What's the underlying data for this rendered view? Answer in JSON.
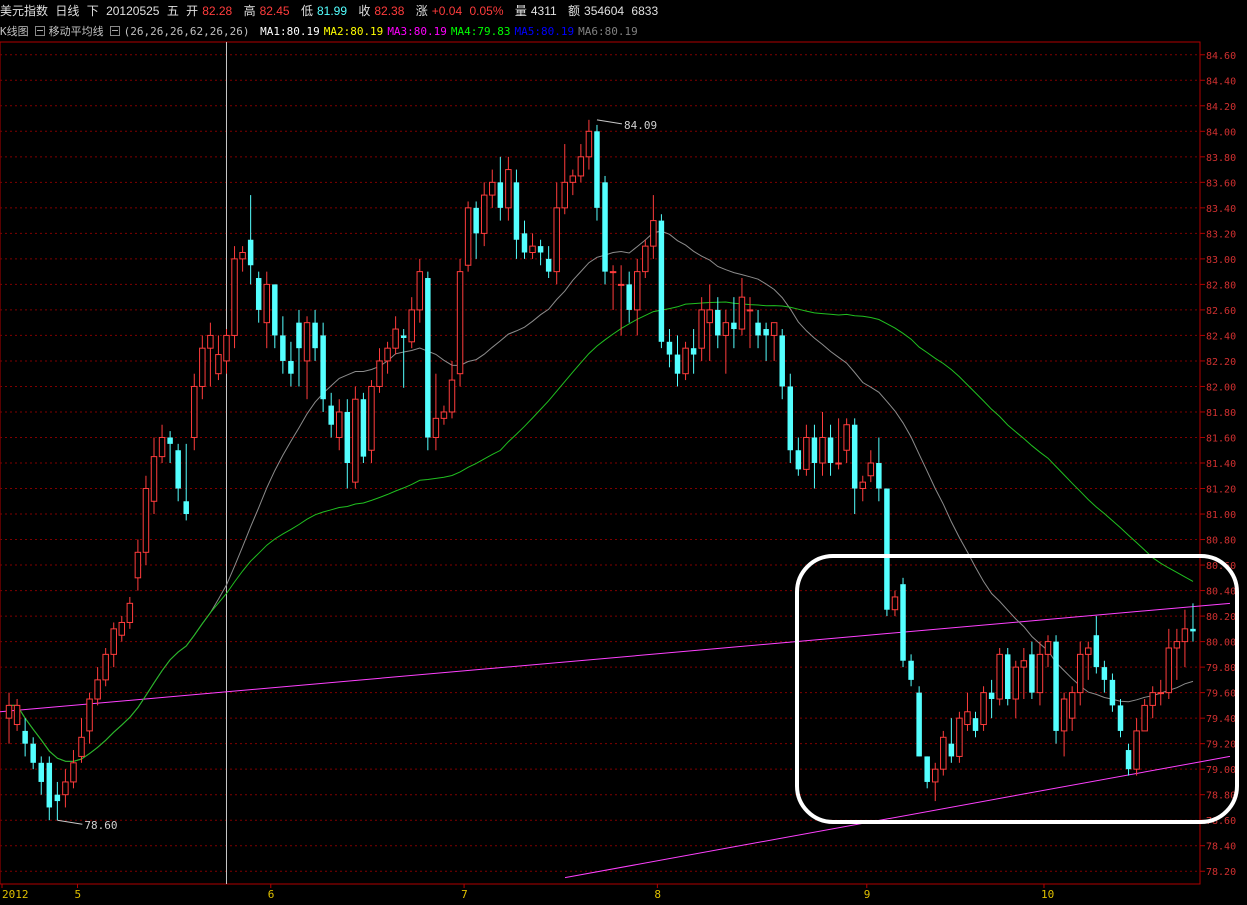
{
  "header": {
    "name": "美元指数",
    "period": "日线",
    "nav": "下",
    "date": "20120525",
    "weekday": "五",
    "open_label": "开",
    "open": "82.28",
    "high_label": "高",
    "high": "82.45",
    "low_label": "低",
    "low": "81.99",
    "close_label": "收",
    "close": "82.38",
    "change_label": "涨",
    "change": "+0.04",
    "change_pct": "0.05%",
    "volume_label": "量",
    "volume": "4311",
    "amount_label": "额",
    "amount": "354604",
    "extra": "6833"
  },
  "indicator_bar": {
    "kline_label": "K线图",
    "ma_label": "移动平均线",
    "ma_params": "(26,26,26,62,26,26)",
    "ma": [
      {
        "label": "MA1:80.19",
        "color": "#ffffff"
      },
      {
        "label": "MA2:80.19",
        "color": "#ffff00"
      },
      {
        "label": "MA3:80.19",
        "color": "#ff00ff"
      },
      {
        "label": "MA4:79.83",
        "color": "#00ff00"
      },
      {
        "label": "MA5:80.19",
        "color": "#0000ff"
      },
      {
        "label": "MA6:80.19",
        "color": "#808080"
      }
    ]
  },
  "colors": {
    "up": "#ff3c3c",
    "down": "#54ffff",
    "grid": "#800000",
    "axis": "#b00000",
    "ma_gray": "#8c8c8c",
    "ma_green": "#20c020",
    "trend": "#ff40ff",
    "highlight": "#ffffff"
  },
  "chart_data": {
    "type": "candlestick",
    "ylim": [
      78.1,
      84.7
    ],
    "y_ticks": [
      "84.60",
      "84.40",
      "84.20",
      "84.00",
      "83.80",
      "83.60",
      "83.40",
      "83.20",
      "83.00",
      "82.80",
      "82.60",
      "82.40",
      "82.20",
      "82.00",
      "81.80",
      "81.60",
      "81.40",
      "81.20",
      "81.00",
      "80.80",
      "80.60",
      "80.40",
      "80.20",
      "80.00",
      "79.80",
      "79.60",
      "79.40",
      "79.20",
      "79.00",
      "78.80",
      "78.60",
      "78.40",
      "78.20"
    ],
    "x_labels": [
      {
        "label": "2012",
        "index": 0
      },
      {
        "label": "5",
        "index": 9
      },
      {
        "label": "6",
        "index": 33
      },
      {
        "label": "7",
        "index": 57
      },
      {
        "label": "8",
        "index": 81
      },
      {
        "label": "9",
        "index": 107
      },
      {
        "label": "10",
        "index": 129
      }
    ],
    "annotations": [
      {
        "text": "84.09",
        "index": 73,
        "value": 84.09
      },
      {
        "text": "78.60",
        "index": 6,
        "value": 78.6
      }
    ],
    "cursor_index": 27,
    "candles": [
      [
        79.4,
        79.5,
        79.2,
        79.6
      ],
      [
        79.35,
        79.5,
        79.3,
        79.55
      ],
      [
        79.3,
        79.2,
        79.1,
        79.4
      ],
      [
        79.2,
        79.05,
        79.0,
        79.25
      ],
      [
        79.05,
        78.9,
        78.8,
        79.1
      ],
      [
        79.05,
        78.7,
        78.6,
        79.1
      ],
      [
        78.8,
        78.75,
        78.6,
        78.9
      ],
      [
        78.8,
        78.9,
        78.7,
        79.0
      ],
      [
        78.9,
        79.05,
        78.85,
        79.15
      ],
      [
        79.1,
        79.25,
        79.05,
        79.4
      ],
      [
        79.3,
        79.55,
        79.2,
        79.6
      ],
      [
        79.55,
        79.7,
        79.5,
        79.8
      ],
      [
        79.7,
        79.9,
        79.65,
        79.95
      ],
      [
        79.9,
        80.1,
        79.8,
        80.15
      ],
      [
        80.05,
        80.15,
        80.0,
        80.2
      ],
      [
        80.15,
        80.3,
        80.1,
        80.35
      ],
      [
        80.5,
        80.7,
        80.4,
        80.8
      ],
      [
        80.7,
        81.2,
        80.6,
        81.3
      ],
      [
        81.1,
        81.45,
        81.0,
        81.6
      ],
      [
        81.45,
        81.6,
        81.4,
        81.7
      ],
      [
        81.6,
        81.55,
        81.4,
        81.65
      ],
      [
        81.5,
        81.2,
        81.1,
        81.55
      ],
      [
        81.1,
        81.0,
        80.95,
        81.55
      ],
      [
        81.6,
        82.0,
        81.5,
        82.1
      ],
      [
        82.0,
        82.3,
        81.9,
        82.4
      ],
      [
        82.3,
        82.4,
        82.0,
        82.5
      ],
      [
        82.1,
        82.25,
        82.05,
        82.4
      ],
      [
        82.2,
        82.4,
        82.1,
        82.45
      ],
      [
        82.4,
        83.0,
        82.3,
        83.1
      ],
      [
        83.0,
        83.05,
        82.9,
        83.1
      ],
      [
        83.15,
        82.95,
        82.8,
        83.5
      ],
      [
        82.85,
        82.6,
        82.5,
        82.9
      ],
      [
        82.5,
        82.8,
        82.3,
        82.9
      ],
      [
        82.8,
        82.4,
        82.3,
        82.8
      ],
      [
        82.4,
        82.2,
        82.1,
        82.55
      ],
      [
        82.2,
        82.1,
        82.0,
        82.35
      ],
      [
        82.5,
        82.3,
        82.0,
        82.6
      ],
      [
        82.2,
        82.5,
        81.9,
        82.55
      ],
      [
        82.5,
        82.3,
        82.2,
        82.6
      ],
      [
        82.4,
        81.9,
        81.8,
        82.5
      ],
      [
        81.85,
        81.7,
        81.6,
        81.95
      ],
      [
        81.6,
        81.8,
        81.5,
        81.9
      ],
      [
        81.8,
        81.4,
        81.2,
        81.9
      ],
      [
        81.25,
        81.9,
        81.2,
        82.0
      ],
      [
        81.9,
        81.45,
        81.4,
        81.95
      ],
      [
        81.5,
        82.0,
        81.4,
        82.05
      ],
      [
        82.0,
        82.2,
        81.95,
        82.3
      ],
      [
        82.2,
        82.3,
        82.1,
        82.35
      ],
      [
        82.3,
        82.45,
        82.25,
        82.55
      ],
      [
        82.4,
        82.38,
        81.99,
        82.45
      ],
      [
        82.35,
        82.6,
        82.3,
        82.7
      ],
      [
        82.6,
        82.9,
        82.5,
        83.0
      ],
      [
        82.85,
        81.6,
        81.5,
        82.9
      ],
      [
        81.6,
        81.75,
        81.5,
        82.1
      ],
      [
        81.75,
        81.8,
        81.7,
        81.85
      ],
      [
        81.8,
        82.05,
        81.75,
        82.2
      ],
      [
        82.1,
        82.9,
        82.0,
        83.0
      ],
      [
        82.95,
        83.4,
        82.9,
        83.45
      ],
      [
        83.4,
        83.2,
        83.0,
        83.45
      ],
      [
        83.2,
        83.5,
        83.1,
        83.6
      ],
      [
        83.5,
        83.6,
        83.4,
        83.7
      ],
      [
        83.6,
        83.4,
        83.3,
        83.8
      ],
      [
        83.4,
        83.7,
        83.3,
        83.8
      ],
      [
        83.6,
        83.15,
        83.0,
        83.7
      ],
      [
        83.2,
        83.05,
        83.0,
        83.3
      ],
      [
        83.05,
        83.1,
        83.0,
        83.2
      ],
      [
        83.1,
        83.05,
        82.95,
        83.15
      ],
      [
        83.0,
        82.9,
        82.85,
        83.1
      ],
      [
        82.9,
        83.4,
        82.8,
        83.6
      ],
      [
        83.4,
        83.6,
        83.35,
        83.9
      ],
      [
        83.6,
        83.65,
        83.5,
        83.7
      ],
      [
        83.65,
        83.8,
        83.6,
        83.9
      ],
      [
        83.8,
        84.0,
        83.7,
        84.09
      ],
      [
        84.0,
        83.4,
        83.3,
        84.05
      ],
      [
        83.6,
        82.9,
        82.8,
        83.65
      ],
      [
        82.9,
        82.9,
        82.6,
        82.95
      ],
      [
        82.8,
        82.8,
        82.4,
        82.95
      ],
      [
        82.8,
        82.6,
        82.5,
        82.9
      ],
      [
        82.6,
        82.9,
        82.4,
        83.0
      ],
      [
        82.9,
        83.1,
        82.85,
        83.15
      ],
      [
        83.1,
        83.3,
        83.0,
        83.5
      ],
      [
        83.3,
        82.35,
        82.3,
        83.35
      ],
      [
        82.35,
        82.25,
        82.15,
        82.45
      ],
      [
        82.25,
        82.1,
        82.0,
        82.4
      ],
      [
        82.1,
        82.3,
        82.05,
        82.35
      ],
      [
        82.3,
        82.25,
        82.1,
        82.45
      ],
      [
        82.3,
        82.6,
        82.2,
        82.7
      ],
      [
        82.5,
        82.6,
        82.2,
        82.8
      ],
      [
        82.6,
        82.4,
        82.3,
        82.7
      ],
      [
        82.4,
        82.5,
        82.1,
        82.6
      ],
      [
        82.5,
        82.45,
        82.3,
        82.7
      ],
      [
        82.45,
        82.7,
        82.4,
        82.85
      ],
      [
        82.6,
        82.6,
        82.3,
        82.7
      ],
      [
        82.5,
        82.4,
        82.3,
        82.6
      ],
      [
        82.45,
        82.4,
        82.2,
        82.5
      ],
      [
        82.4,
        82.5,
        82.2,
        82.5
      ],
      [
        82.4,
        82.0,
        81.9,
        82.45
      ],
      [
        82.0,
        81.5,
        81.4,
        82.1
      ],
      [
        81.5,
        81.35,
        81.3,
        81.6
      ],
      [
        81.35,
        81.6,
        81.3,
        81.7
      ],
      [
        81.6,
        81.4,
        81.2,
        81.7
      ],
      [
        81.4,
        81.6,
        81.3,
        81.8
      ],
      [
        81.6,
        81.4,
        81.3,
        81.7
      ],
      [
        81.4,
        81.4,
        81.35,
        81.75
      ],
      [
        81.5,
        81.7,
        81.4,
        81.75
      ],
      [
        81.7,
        81.2,
        81.0,
        81.75
      ],
      [
        81.2,
        81.25,
        81.1,
        81.3
      ],
      [
        81.3,
        81.4,
        81.25,
        81.5
      ],
      [
        81.4,
        81.2,
        81.1,
        81.6
      ],
      [
        81.2,
        80.25,
        80.2,
        81.2
      ],
      [
        80.25,
        80.35,
        80.2,
        80.4
      ],
      [
        80.45,
        79.85,
        79.8,
        80.5
      ],
      [
        79.85,
        79.7,
        79.65,
        79.9
      ],
      [
        79.6,
        79.1,
        79.1,
        79.65
      ],
      [
        79.1,
        78.9,
        78.85,
        79.1
      ],
      [
        78.9,
        79.0,
        78.75,
        79.05
      ],
      [
        79.0,
        79.25,
        78.95,
        79.3
      ],
      [
        79.2,
        79.1,
        79.05,
        79.4
      ],
      [
        79.1,
        79.4,
        79.05,
        79.45
      ],
      [
        79.35,
        79.45,
        79.3,
        79.6
      ],
      [
        79.4,
        79.3,
        79.25,
        79.45
      ],
      [
        79.35,
        79.6,
        79.3,
        79.65
      ],
      [
        79.6,
        79.55,
        79.4,
        79.7
      ],
      [
        79.55,
        79.9,
        79.5,
        79.95
      ],
      [
        79.9,
        79.55,
        79.5,
        79.95
      ],
      [
        79.55,
        79.8,
        79.4,
        79.85
      ],
      [
        79.8,
        79.85,
        79.55,
        79.95
      ],
      [
        79.9,
        79.6,
        79.55,
        80.0
      ],
      [
        79.6,
        79.9,
        79.5,
        80.0
      ],
      [
        79.9,
        80.0,
        79.8,
        80.05
      ],
      [
        80.0,
        79.3,
        79.2,
        80.05
      ],
      [
        79.3,
        79.55,
        79.1,
        79.6
      ],
      [
        79.4,
        79.6,
        79.3,
        79.65
      ],
      [
        79.6,
        79.9,
        79.5,
        80.0
      ],
      [
        79.9,
        79.95,
        79.7,
        80.0
      ],
      [
        80.05,
        79.8,
        79.75,
        80.2
      ],
      [
        79.8,
        79.7,
        79.6,
        79.85
      ],
      [
        79.7,
        79.5,
        79.45,
        79.75
      ],
      [
        79.5,
        79.3,
        79.25,
        79.55
      ],
      [
        79.15,
        79.0,
        78.95,
        79.2
      ],
      [
        79.0,
        79.3,
        78.95,
        79.4
      ],
      [
        79.3,
        79.5,
        79.3,
        79.55
      ],
      [
        79.5,
        79.6,
        79.4,
        79.65
      ],
      [
        79.6,
        79.6,
        79.5,
        79.7
      ],
      [
        79.6,
        79.95,
        79.55,
        80.1
      ],
      [
        79.95,
        80.0,
        79.7,
        80.1
      ],
      [
        80.0,
        80.1,
        79.8,
        80.25
      ],
      [
        80.1,
        80.08,
        80.0,
        80.3
      ]
    ]
  }
}
